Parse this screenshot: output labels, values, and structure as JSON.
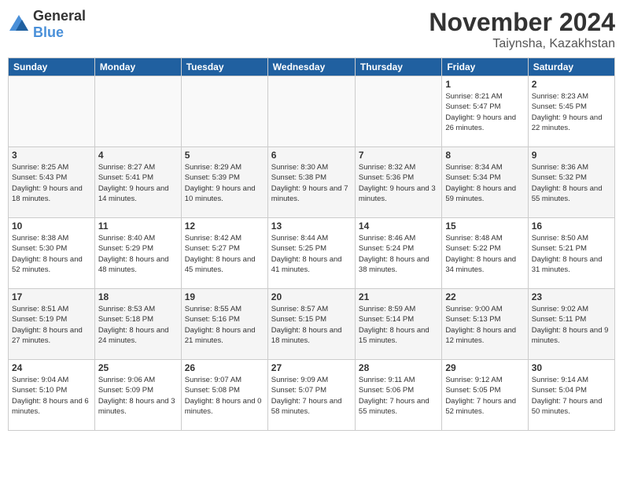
{
  "logo": {
    "general": "General",
    "blue": "Blue"
  },
  "title": "November 2024",
  "subtitle": "Taiynsha, Kazakhstan",
  "days_header": [
    "Sunday",
    "Monday",
    "Tuesday",
    "Wednesday",
    "Thursday",
    "Friday",
    "Saturday"
  ],
  "weeks": [
    [
      {
        "day": "",
        "info": ""
      },
      {
        "day": "",
        "info": ""
      },
      {
        "day": "",
        "info": ""
      },
      {
        "day": "",
        "info": ""
      },
      {
        "day": "",
        "info": ""
      },
      {
        "day": "1",
        "info": "Sunrise: 8:21 AM\nSunset: 5:47 PM\nDaylight: 9 hours and 26 minutes."
      },
      {
        "day": "2",
        "info": "Sunrise: 8:23 AM\nSunset: 5:45 PM\nDaylight: 9 hours and 22 minutes."
      }
    ],
    [
      {
        "day": "3",
        "info": "Sunrise: 8:25 AM\nSunset: 5:43 PM\nDaylight: 9 hours and 18 minutes."
      },
      {
        "day": "4",
        "info": "Sunrise: 8:27 AM\nSunset: 5:41 PM\nDaylight: 9 hours and 14 minutes."
      },
      {
        "day": "5",
        "info": "Sunrise: 8:29 AM\nSunset: 5:39 PM\nDaylight: 9 hours and 10 minutes."
      },
      {
        "day": "6",
        "info": "Sunrise: 8:30 AM\nSunset: 5:38 PM\nDaylight: 9 hours and 7 minutes."
      },
      {
        "day": "7",
        "info": "Sunrise: 8:32 AM\nSunset: 5:36 PM\nDaylight: 9 hours and 3 minutes."
      },
      {
        "day": "8",
        "info": "Sunrise: 8:34 AM\nSunset: 5:34 PM\nDaylight: 8 hours and 59 minutes."
      },
      {
        "day": "9",
        "info": "Sunrise: 8:36 AM\nSunset: 5:32 PM\nDaylight: 8 hours and 55 minutes."
      }
    ],
    [
      {
        "day": "10",
        "info": "Sunrise: 8:38 AM\nSunset: 5:30 PM\nDaylight: 8 hours and 52 minutes."
      },
      {
        "day": "11",
        "info": "Sunrise: 8:40 AM\nSunset: 5:29 PM\nDaylight: 8 hours and 48 minutes."
      },
      {
        "day": "12",
        "info": "Sunrise: 8:42 AM\nSunset: 5:27 PM\nDaylight: 8 hours and 45 minutes."
      },
      {
        "day": "13",
        "info": "Sunrise: 8:44 AM\nSunset: 5:25 PM\nDaylight: 8 hours and 41 minutes."
      },
      {
        "day": "14",
        "info": "Sunrise: 8:46 AM\nSunset: 5:24 PM\nDaylight: 8 hours and 38 minutes."
      },
      {
        "day": "15",
        "info": "Sunrise: 8:48 AM\nSunset: 5:22 PM\nDaylight: 8 hours and 34 minutes."
      },
      {
        "day": "16",
        "info": "Sunrise: 8:50 AM\nSunset: 5:21 PM\nDaylight: 8 hours and 31 minutes."
      }
    ],
    [
      {
        "day": "17",
        "info": "Sunrise: 8:51 AM\nSunset: 5:19 PM\nDaylight: 8 hours and 27 minutes."
      },
      {
        "day": "18",
        "info": "Sunrise: 8:53 AM\nSunset: 5:18 PM\nDaylight: 8 hours and 24 minutes."
      },
      {
        "day": "19",
        "info": "Sunrise: 8:55 AM\nSunset: 5:16 PM\nDaylight: 8 hours and 21 minutes."
      },
      {
        "day": "20",
        "info": "Sunrise: 8:57 AM\nSunset: 5:15 PM\nDaylight: 8 hours and 18 minutes."
      },
      {
        "day": "21",
        "info": "Sunrise: 8:59 AM\nSunset: 5:14 PM\nDaylight: 8 hours and 15 minutes."
      },
      {
        "day": "22",
        "info": "Sunrise: 9:00 AM\nSunset: 5:13 PM\nDaylight: 8 hours and 12 minutes."
      },
      {
        "day": "23",
        "info": "Sunrise: 9:02 AM\nSunset: 5:11 PM\nDaylight: 8 hours and 9 minutes."
      }
    ],
    [
      {
        "day": "24",
        "info": "Sunrise: 9:04 AM\nSunset: 5:10 PM\nDaylight: 8 hours and 6 minutes."
      },
      {
        "day": "25",
        "info": "Sunrise: 9:06 AM\nSunset: 5:09 PM\nDaylight: 8 hours and 3 minutes."
      },
      {
        "day": "26",
        "info": "Sunrise: 9:07 AM\nSunset: 5:08 PM\nDaylight: 8 hours and 0 minutes."
      },
      {
        "day": "27",
        "info": "Sunrise: 9:09 AM\nSunset: 5:07 PM\nDaylight: 7 hours and 58 minutes."
      },
      {
        "day": "28",
        "info": "Sunrise: 9:11 AM\nSunset: 5:06 PM\nDaylight: 7 hours and 55 minutes."
      },
      {
        "day": "29",
        "info": "Sunrise: 9:12 AM\nSunset: 5:05 PM\nDaylight: 7 hours and 52 minutes."
      },
      {
        "day": "30",
        "info": "Sunrise: 9:14 AM\nSunset: 5:04 PM\nDaylight: 7 hours and 50 minutes."
      }
    ]
  ]
}
